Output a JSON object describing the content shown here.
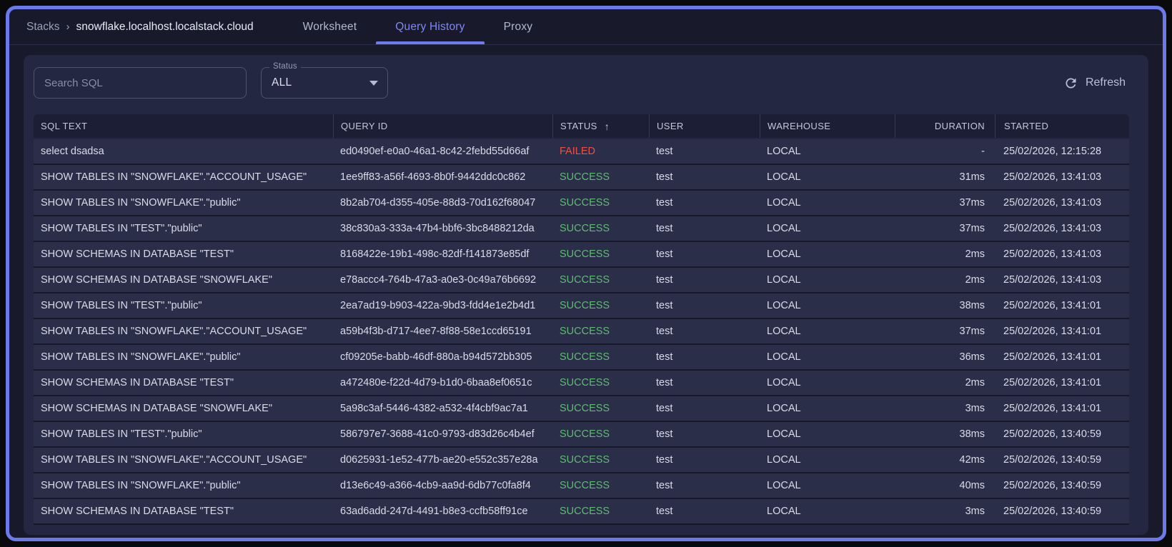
{
  "breadcrumb": {
    "root": "Stacks",
    "separator": "›",
    "current": "snowflake.localhost.localstack.cloud"
  },
  "tabs": [
    {
      "label": "Worksheet",
      "active": false
    },
    {
      "label": "Query History",
      "active": true
    },
    {
      "label": "Proxy",
      "active": false
    }
  ],
  "toolbar": {
    "search_placeholder": "Search SQL",
    "status_label": "Status",
    "status_value": "ALL",
    "refresh_label": "Refresh",
    "refresh_icon": "refresh-icon",
    "status_caret_icon": "chevron-down-icon"
  },
  "table": {
    "columns": [
      {
        "label": "SQL TEXT"
      },
      {
        "label": "QUERY ID"
      },
      {
        "label": "STATUS",
        "sorted": "asc",
        "sort_icon": "arrow-up-icon"
      },
      {
        "label": "USER"
      },
      {
        "label": "WAREHOUSE"
      },
      {
        "label": "DURATION",
        "align": "right"
      },
      {
        "label": "STARTED"
      }
    ],
    "rows": [
      {
        "sql": "select dsadsa",
        "query_id": "ed0490ef-e0a0-46a1-8c42-2febd55d66af",
        "status": "FAILED",
        "user": "test",
        "warehouse": "LOCAL",
        "duration": "-",
        "started": "25/02/2026, 12:15:28"
      },
      {
        "sql": "SHOW TABLES IN \"SNOWFLAKE\".\"ACCOUNT_USAGE\"",
        "query_id": "1ee9ff83-a56f-4693-8b0f-9442ddc0c862",
        "status": "SUCCESS",
        "user": "test",
        "warehouse": "LOCAL",
        "duration": "31ms",
        "started": "25/02/2026, 13:41:03"
      },
      {
        "sql": "SHOW TABLES IN \"SNOWFLAKE\".\"public\"",
        "query_id": "8b2ab704-d355-405e-88d3-70d162f68047",
        "status": "SUCCESS",
        "user": "test",
        "warehouse": "LOCAL",
        "duration": "37ms",
        "started": "25/02/2026, 13:41:03"
      },
      {
        "sql": "SHOW TABLES IN \"TEST\".\"public\"",
        "query_id": "38c830a3-333a-47b4-bbf6-3bc8488212da",
        "status": "SUCCESS",
        "user": "test",
        "warehouse": "LOCAL",
        "duration": "37ms",
        "started": "25/02/2026, 13:41:03"
      },
      {
        "sql": "SHOW SCHEMAS IN DATABASE \"TEST\"",
        "query_id": "8168422e-19b1-498c-82df-f141873e85df",
        "status": "SUCCESS",
        "user": "test",
        "warehouse": "LOCAL",
        "duration": "2ms",
        "started": "25/02/2026, 13:41:03"
      },
      {
        "sql": "SHOW SCHEMAS IN DATABASE \"SNOWFLAKE\"",
        "query_id": "e78accc4-764b-47a3-a0e3-0c49a76b6692",
        "status": "SUCCESS",
        "user": "test",
        "warehouse": "LOCAL",
        "duration": "2ms",
        "started": "25/02/2026, 13:41:03"
      },
      {
        "sql": "SHOW TABLES IN \"TEST\".\"public\"",
        "query_id": "2ea7ad19-b903-422a-9bd3-fdd4e1e2b4d1",
        "status": "SUCCESS",
        "user": "test",
        "warehouse": "LOCAL",
        "duration": "38ms",
        "started": "25/02/2026, 13:41:01"
      },
      {
        "sql": "SHOW TABLES IN \"SNOWFLAKE\".\"ACCOUNT_USAGE\"",
        "query_id": "a59b4f3b-d717-4ee7-8f88-58e1ccd65191",
        "status": "SUCCESS",
        "user": "test",
        "warehouse": "LOCAL",
        "duration": "37ms",
        "started": "25/02/2026, 13:41:01"
      },
      {
        "sql": "SHOW TABLES IN \"SNOWFLAKE\".\"public\"",
        "query_id": "cf09205e-babb-46df-880a-b94d572bb305",
        "status": "SUCCESS",
        "user": "test",
        "warehouse": "LOCAL",
        "duration": "36ms",
        "started": "25/02/2026, 13:41:01"
      },
      {
        "sql": "SHOW SCHEMAS IN DATABASE \"TEST\"",
        "query_id": "a472480e-f22d-4d79-b1d0-6baa8ef0651c",
        "status": "SUCCESS",
        "user": "test",
        "warehouse": "LOCAL",
        "duration": "2ms",
        "started": "25/02/2026, 13:41:01"
      },
      {
        "sql": "SHOW SCHEMAS IN DATABASE \"SNOWFLAKE\"",
        "query_id": "5a98c3af-5446-4382-a532-4f4cbf9ac7a1",
        "status": "SUCCESS",
        "user": "test",
        "warehouse": "LOCAL",
        "duration": "3ms",
        "started": "25/02/2026, 13:41:01"
      },
      {
        "sql": "SHOW TABLES IN \"TEST\".\"public\"",
        "query_id": "586797e7-3688-41c0-9793-d83d26c4b4ef",
        "status": "SUCCESS",
        "user": "test",
        "warehouse": "LOCAL",
        "duration": "38ms",
        "started": "25/02/2026, 13:40:59"
      },
      {
        "sql": "SHOW TABLES IN \"SNOWFLAKE\".\"ACCOUNT_USAGE\"",
        "query_id": "d0625931-1e52-477b-ae20-e552c357e28a",
        "status": "SUCCESS",
        "user": "test",
        "warehouse": "LOCAL",
        "duration": "42ms",
        "started": "25/02/2026, 13:40:59"
      },
      {
        "sql": "SHOW TABLES IN \"SNOWFLAKE\".\"public\"",
        "query_id": "d13e6c49-a366-4cb9-aa9d-6db77c0fa8f4",
        "status": "SUCCESS",
        "user": "test",
        "warehouse": "LOCAL",
        "duration": "40ms",
        "started": "25/02/2026, 13:40:59"
      },
      {
        "sql": "SHOW SCHEMAS IN DATABASE \"TEST\"",
        "query_id": "63ad6add-247d-4491-b8e3-ccfb58ff91ce",
        "status": "SUCCESS",
        "user": "test",
        "warehouse": "LOCAL",
        "duration": "3ms",
        "started": "25/02/2026, 13:40:59"
      }
    ]
  },
  "colors": {
    "accent": "#6c79e8",
    "success": "#5fbb72",
    "failed": "#e65349"
  }
}
